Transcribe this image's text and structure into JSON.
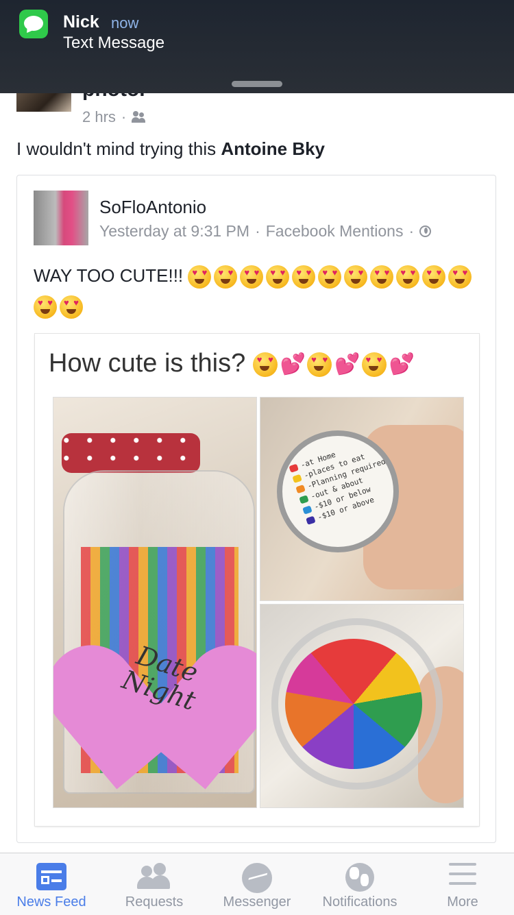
{
  "notification": {
    "sender": "Nick",
    "time": "now",
    "message": "Text Message",
    "app_icon": "messages-icon"
  },
  "previous_story": {
    "title_fragment": "photo.",
    "time": "2 hrs",
    "audience_icon": "friends-icon"
  },
  "post": {
    "text": "I wouldn't mind trying this ",
    "tagged_name": "Antoine Bky"
  },
  "shared_post": {
    "author": "SoFloAntonio",
    "timestamp": "Yesterday at 9:31 PM",
    "separator": " · ",
    "source": "Facebook Mentions",
    "audience_icon": "globe-icon",
    "caption": "WAY TOO CUTE!!!",
    "caption_emoji_count": 13,
    "photo": {
      "title": "How cute is this?",
      "heart_text": "Date Night",
      "lid_list": [
        "-at Home",
        "-places to eat",
        "-Planning required",
        "-out & about",
        "-$10 or below",
        "-$10 or above"
      ],
      "lid_colors": [
        "#e63b3b",
        "#f2c21d",
        "#f08a24",
        "#2f9d4f",
        "#2a8fd6",
        "#3a2fa5"
      ]
    }
  },
  "tabbar": {
    "tabs": [
      {
        "label": "News Feed",
        "icon": "news-feed-icon",
        "active": true
      },
      {
        "label": "Requests",
        "icon": "friend-requests-icon",
        "active": false
      },
      {
        "label": "Messenger",
        "icon": "messenger-icon",
        "active": false
      },
      {
        "label": "Notifications",
        "icon": "notifications-globe-icon",
        "active": false
      },
      {
        "label": "More",
        "icon": "menu-icon",
        "active": false
      }
    ]
  },
  "colors": {
    "accent": "#4a7de8",
    "inactive": "#9197a3",
    "text_secondary": "#90949c",
    "messages_green": "#2fc94a"
  }
}
